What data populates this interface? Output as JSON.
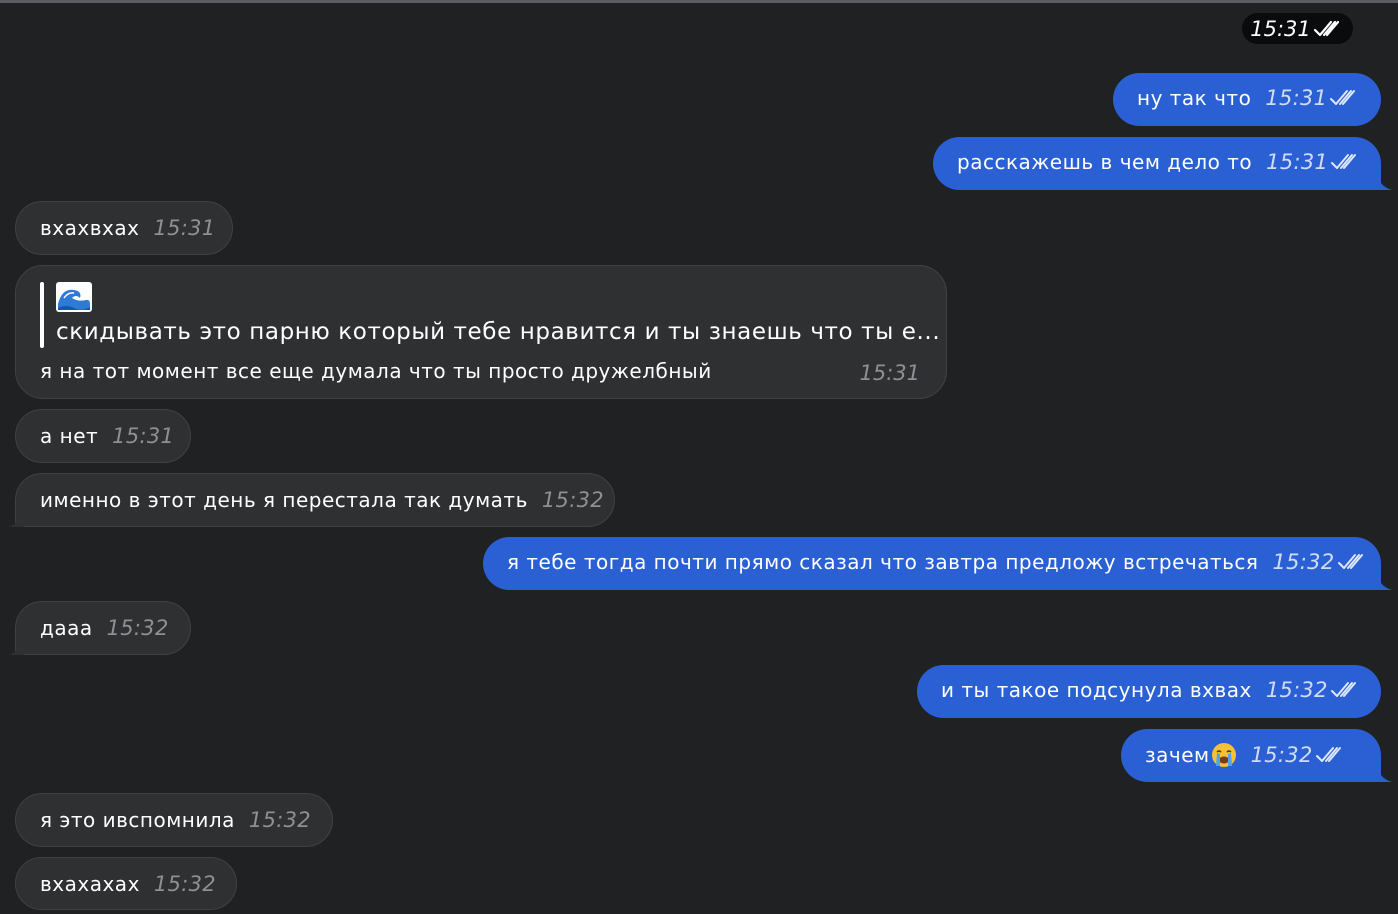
{
  "date_chip": {
    "time": "15:31"
  },
  "messages": [
    {
      "text": "ну так что",
      "time": "15:31"
    },
    {
      "text": "расскажешь в чем дело то",
      "time": "15:31"
    },
    {
      "text": "вхахвхах",
      "time": "15:31"
    },
    {
      "reply_quote": "скидывать это парню который тебе нравится и ты знаешь что ты е...",
      "text": "я на тот момент все еще думала что ты просто дружелбный",
      "time": "15:31"
    },
    {
      "text": "а нет",
      "time": "15:31"
    },
    {
      "text": "именно в этот день я перестала так думать",
      "time": "15:32"
    },
    {
      "text": "я тебе тогда почти прямо сказал что завтра предложу встречаться",
      "time": "15:32"
    },
    {
      "text": "дааа",
      "time": "15:32"
    },
    {
      "text": "и ты такое подсунула вхвах",
      "time": "15:32"
    },
    {
      "text": "зачем",
      "time": "15:32"
    },
    {
      "text": "я это ивспомнила",
      "time": "15:32"
    },
    {
      "text": "вхахахах",
      "time": "15:32"
    }
  ],
  "colors": {
    "background": "#1f2123",
    "incoming_bubble": "#2f3032",
    "outgoing_bubble": "#2a60d3",
    "date_chip": "#0a0b0c"
  },
  "icons": {
    "read_status": "double-check-icon",
    "reply_emoji": "water-wave-emoji",
    "crying_emoji": "loudly-crying-face-emoji"
  }
}
